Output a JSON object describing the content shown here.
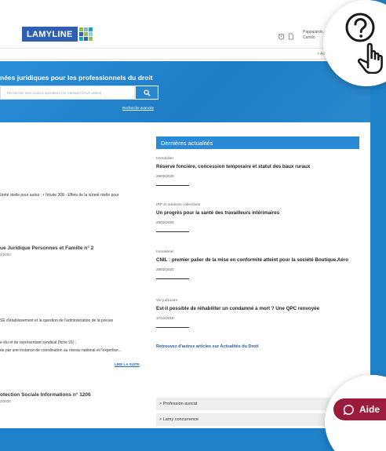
{
  "header": {
    "logo": "LAMYLINE",
    "logo_square_colors": [
      "#8ec63f",
      "#2f5fb1",
      "#00a9e0",
      "#2f5fb1",
      "#8ec63f",
      "#00a9e0",
      "#00a9e0",
      "#2f5fb1",
      "#8ec63f"
    ],
    "user_line1": "Pappalardo,",
    "user_line2": "Camilo",
    "icons": [
      "alarm-icon",
      "document-icon"
    ]
  },
  "breadcrumb": "> Ac",
  "hero": {
    "title": "nées juridiques pour les professionnels du droit",
    "search_placeholder": "Rechercher nom ou avec opérateurs (ex: transport SAUF aérien)",
    "advanced_link": "Recherche avancée"
  },
  "left": {
    "line1": "ûreté réelle pour autrui ; • l'étude 308 - Effets de la sûreté réelle pour",
    "title2": "ue Juridique Personnes et Famille n° 2",
    "date2": "2/2020",
    "line3": "SE d'établissement et la question de l'administration de la preuve",
    "line4a": "e élu et de représentant syndical (fiche 91) ;",
    "line4b": "ée par une instance de coordination au niveau national et l'expertise...",
    "read_more": "LIRE LA SUITE",
    "title5": "otection Sociale Informations n° 1206",
    "date5": "2/2020"
  },
  "news": {
    "heading": "Dernières actualités",
    "items": [
      {
        "category": "Immobilier",
        "title": "Réserve foncière, concession temporaire et statut des baux ruraux",
        "date": "28/02/2020"
      },
      {
        "category": "IRP et relations collectives",
        "title": "Un progrès pour la santé des travailleurs intérimaires",
        "date": "28/02/2020"
      },
      {
        "category": "Immatériel",
        "title": "CNIL : premier palier de la mise en conformité atteint pour la société Boutique.Aéro",
        "date": "28/02/2020"
      },
      {
        "category": "Vie judiciaire",
        "title": "Est-il possible de réhabiliter un condamné à mort ? Une QPC renvoyée",
        "date": "17/12/2019"
      }
    ],
    "more_link": "Retrouvez d'autres articles sur Actualités du Droit"
  },
  "accordion": [
    "> Profession avocat",
    "> Lamy concurrence"
  ],
  "aide_label": "Aide",
  "colors": {
    "brand": "#2f5fb1",
    "hero": "#1e7cc4",
    "aide": "#9b1b3c",
    "background": "#1f82c9"
  }
}
